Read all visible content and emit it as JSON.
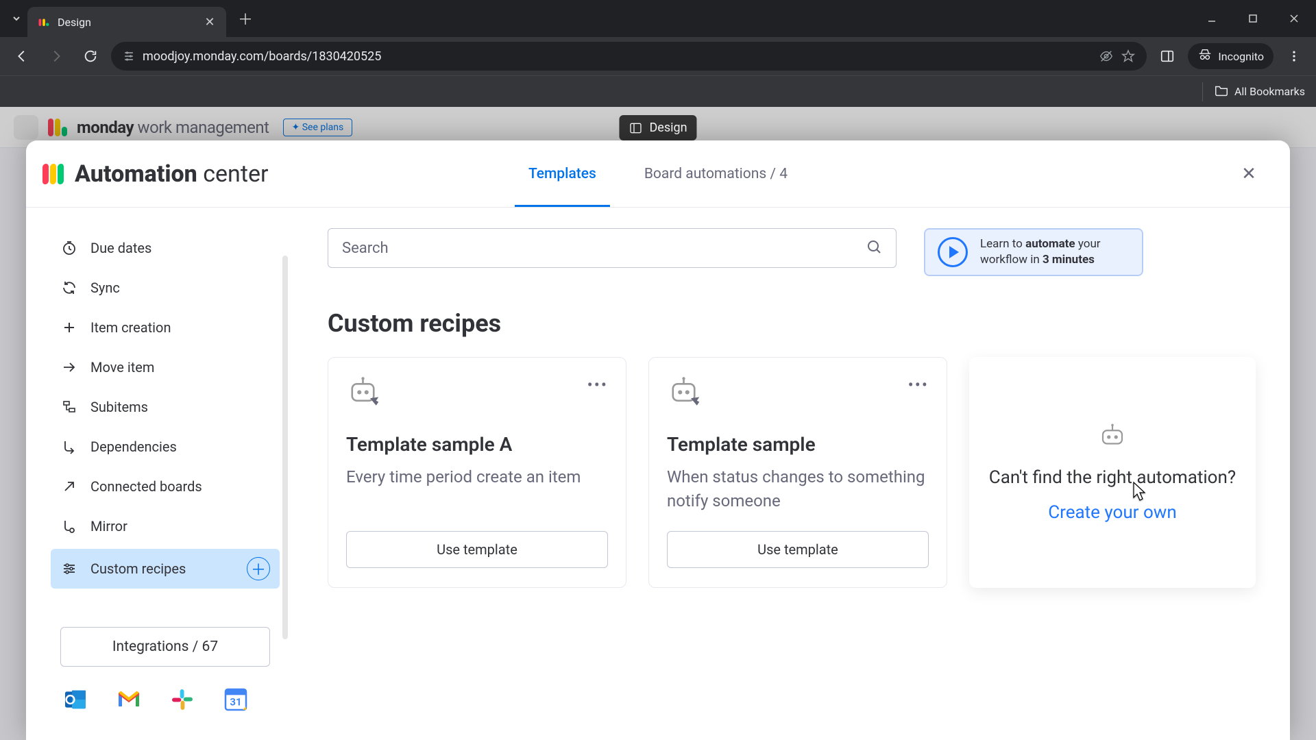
{
  "browser": {
    "tab_title": "Design",
    "url_display": "moodjoy.monday.com/boards/1830420525",
    "incognito_label": "Incognito",
    "all_bookmarks": "All Bookmarks"
  },
  "tooltip": {
    "label": "Design"
  },
  "bg": {
    "logo_bold": "monday",
    "logo_light": "work management",
    "see_plans": "See plans"
  },
  "modal": {
    "title_bold": "Automation",
    "title_light": " center",
    "tabs": {
      "templates": "Templates",
      "board": "Board automations / 4"
    }
  },
  "sidebar": {
    "items": [
      {
        "label": "Due dates"
      },
      {
        "label": "Sync"
      },
      {
        "label": "Item creation"
      },
      {
        "label": "Move item"
      },
      {
        "label": "Subitems"
      },
      {
        "label": "Dependencies"
      },
      {
        "label": "Connected boards"
      },
      {
        "label": "Mirror"
      },
      {
        "label": "Custom recipes"
      }
    ],
    "integrations_label": "Integrations / 67"
  },
  "search": {
    "placeholder": "Search"
  },
  "learn": {
    "line1_pre": "Learn to ",
    "line1_bold": "automate",
    "line1_post": " your",
    "line2_pre": "workflow in ",
    "line2_bold": "3 minutes"
  },
  "section": {
    "title": "Custom recipes"
  },
  "cards": [
    {
      "title": "Template sample A",
      "desc": "Every time period create an item",
      "btn": "Use template"
    },
    {
      "title": "Template sample",
      "desc": "When status changes to something notify someone",
      "btn": "Use template"
    }
  ],
  "create": {
    "question": "Can't find the right automation?",
    "link": "Create your own"
  }
}
